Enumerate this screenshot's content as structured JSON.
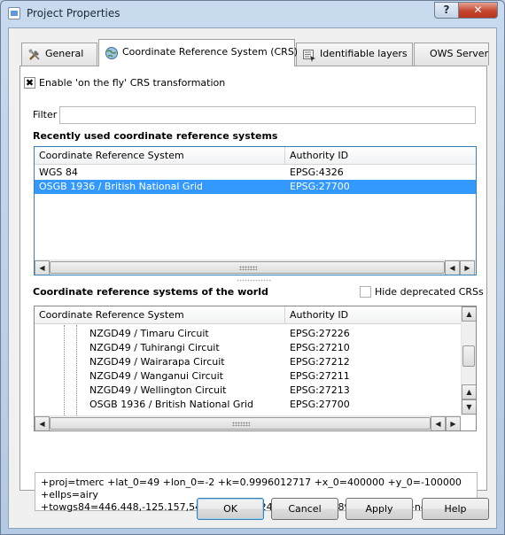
{
  "window": {
    "title": "Project Properties",
    "help_button": "?",
    "close_button": "✕"
  },
  "tabs": [
    {
      "label": "General",
      "icon": "tools-icon"
    },
    {
      "label": "Coordinate Reference System (CRS)",
      "icon": "globe-icon"
    },
    {
      "label": "Identifiable layers",
      "icon": "identify-icon"
    },
    {
      "label": "OWS Server",
      "icon": ""
    }
  ],
  "crs": {
    "enable_otf_label": "Enable 'on the fly' CRS transformation",
    "enable_otf_checked": true,
    "filter_label": "Filter",
    "filter_value": "",
    "recent_title": "Recently used coordinate reference systems",
    "recent_headers": [
      "Coordinate Reference System",
      "Authority ID"
    ],
    "recent_rows": [
      {
        "name": "WGS 84",
        "id": "EPSG:4326",
        "selected": false
      },
      {
        "name": "OSGB 1936 / British National Grid",
        "id": "EPSG:27700",
        "selected": true
      }
    ],
    "world_title": "Coordinate reference systems of the world",
    "hide_deprecated_label": "Hide deprecated CRSs",
    "hide_deprecated_checked": false,
    "world_headers": [
      "Coordinate Reference System",
      "Authority ID"
    ],
    "world_rows": [
      {
        "name": "NZGD49 / Timaru Circuit",
        "id": "EPSG:27226"
      },
      {
        "name": "NZGD49 / Tuhirangi Circuit",
        "id": "EPSG:27210"
      },
      {
        "name": "NZGD49 / Wairarapa Circuit",
        "id": "EPSG:27212"
      },
      {
        "name": "NZGD49 / Wanganui Circuit",
        "id": "EPSG:27211"
      },
      {
        "name": "NZGD49 / Wellington Circuit",
        "id": "EPSG:27213"
      },
      {
        "name": "OSGB 1936 / British National Grid",
        "id": "EPSG:27700"
      }
    ],
    "proj_line1": "+proj=tmerc +lat_0=49 +lon_0=-2 +k=0.9996012717 +x_0=400000 +y_0=-100000 +ellps=airy",
    "proj_line2": "+towgs84=446.448,-125.157,542.06,0.15,0.247,0.842,-20.489 +units=m +no_defs"
  },
  "buttons": {
    "ok": "OK",
    "cancel": "Cancel",
    "apply": "Apply",
    "help": "Help"
  }
}
